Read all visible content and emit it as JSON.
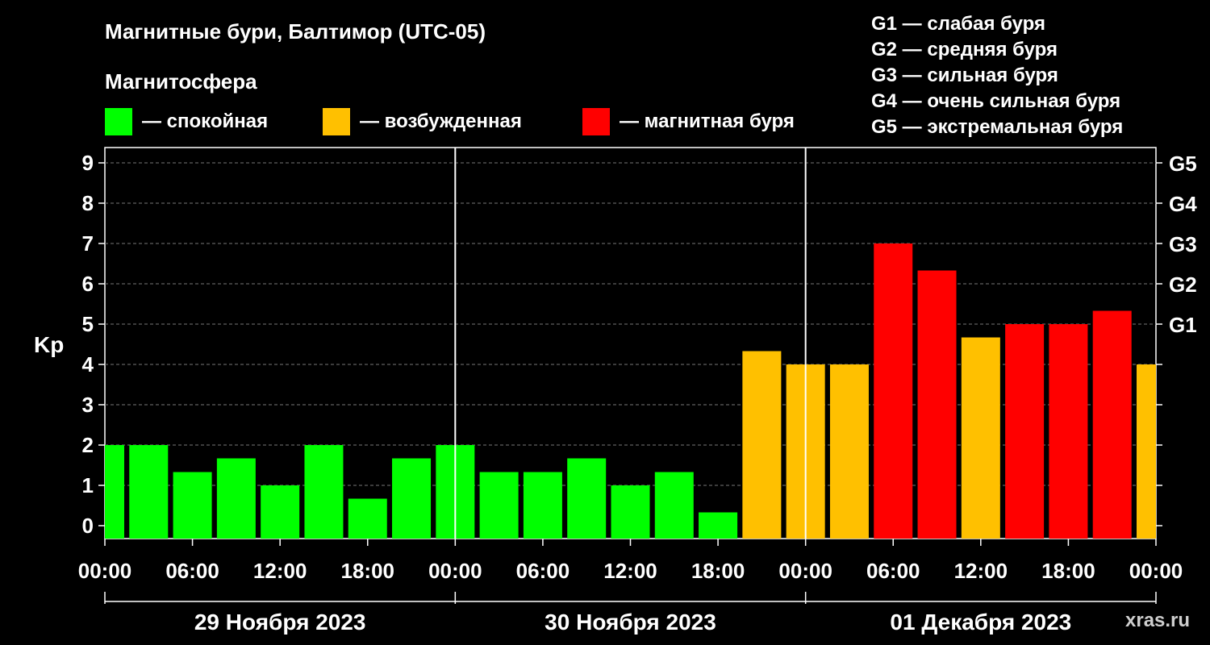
{
  "title": "Магнитные бури, Балтимор (UTC-05)",
  "subtitle": "Магнитосфера",
  "legend": [
    {
      "label": "— спокойная",
      "color": "#00ff00"
    },
    {
      "label": "— возбужденная",
      "color": "#ffc000"
    },
    {
      "label": "— магнитная буря",
      "color": "#ff0000"
    }
  ],
  "g_legend": [
    "G1 — слабая буря",
    "G2 — средняя буря",
    "G3 — сильная буря",
    "G4 — очень сильная буря",
    "G5 — экстремальная буря"
  ],
  "watermark": "xras.ru",
  "chart_data": {
    "type": "bar",
    "ylabel": "Kp",
    "ylim": [
      0,
      9
    ],
    "y_ticks": [
      0,
      1,
      2,
      3,
      4,
      5,
      6,
      7,
      8,
      9
    ],
    "right_labels": [
      {
        "value": 5,
        "label": "G1"
      },
      {
        "value": 6,
        "label": "G2"
      },
      {
        "value": 7,
        "label": "G3"
      },
      {
        "value": 8,
        "label": "G4"
      },
      {
        "value": 9,
        "label": "G5"
      }
    ],
    "x_range_hours": [
      -1,
      71
    ],
    "x_tick_labels": [
      "00:00",
      "06:00",
      "12:00",
      "18:00",
      "00:00",
      "06:00",
      "12:00",
      "18:00",
      "00:00",
      "06:00",
      "12:00",
      "18:00",
      "00:00"
    ],
    "day_labels": [
      "29 Ноября 2023",
      "30 Ноября 2023",
      "01 Декабря 2023"
    ],
    "gridlines": "dashed",
    "values": [
      2,
      2,
      1.33,
      1.67,
      1,
      2,
      0.67,
      1.67,
      2,
      1.33,
      1.33,
      1.67,
      1,
      1.33,
      0.33,
      4.33,
      4,
      4,
      7,
      6.33,
      4.67,
      5,
      5,
      5.33,
      4
    ],
    "bar_hours": [
      -1,
      2,
      5,
      8,
      11,
      14,
      17,
      20,
      23,
      26,
      29,
      32,
      35,
      38,
      41,
      44,
      47,
      50,
      53,
      56,
      59,
      62,
      65,
      68,
      71
    ],
    "colors": {
      "calm": "#00ff00",
      "active": "#ffc000",
      "storm": "#ff0000"
    }
  }
}
